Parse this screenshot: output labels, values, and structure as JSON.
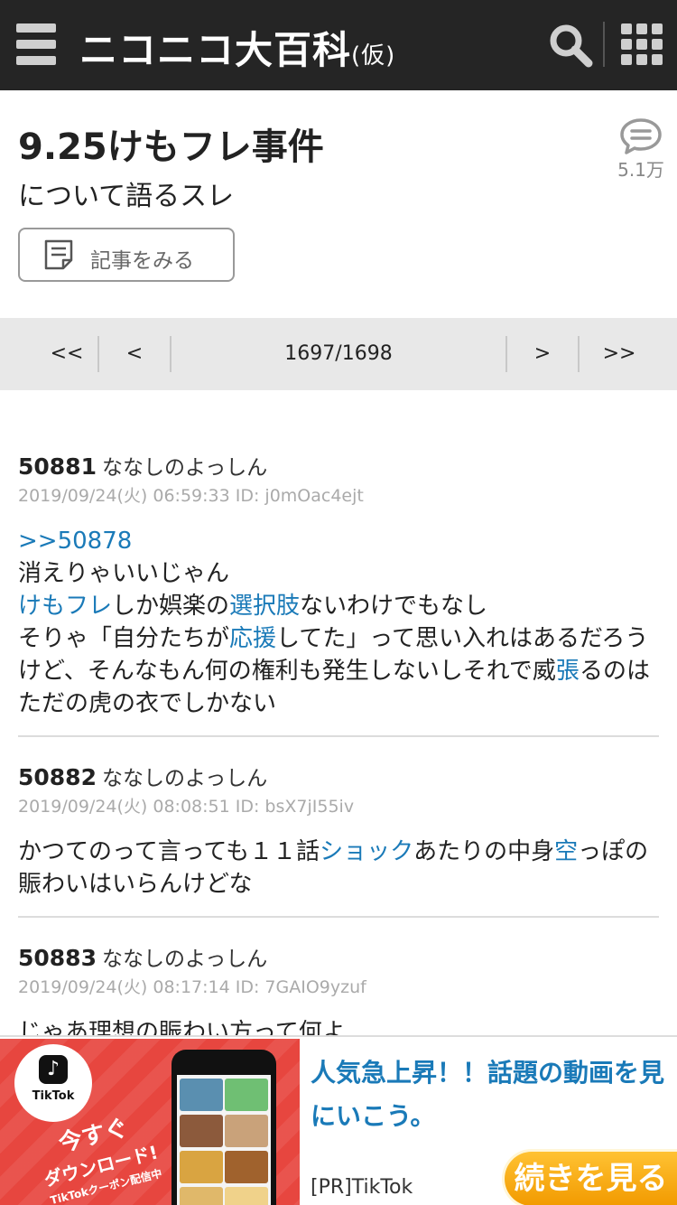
{
  "header": {
    "site_name": "ニコニコ大百科",
    "site_name_suffix": "(仮)",
    "menu_icon": "hamburger-icon",
    "search_icon": "search-icon",
    "apps_icon": "grid-icon",
    "bg_color": "#252525"
  },
  "article": {
    "title": "9.25けもフレ事件",
    "subtitle": "について語るスレ",
    "comment_count": "5.1万",
    "view_article_label": "記事をみる"
  },
  "pager": {
    "first": "<<",
    "prev": "<",
    "position": "1697/1698",
    "next": ">",
    "last": ">>"
  },
  "posts": [
    {
      "number": "50881",
      "name": "ななしのよっしん",
      "meta": "2019/09/24(火) 06:59:33 ID: j0mOac4ejt",
      "reply_link": ">>50878",
      "line1": "消えりゃいいじゃん",
      "link_kemofure": "けもフレ",
      "text_a": "しか娯楽の",
      "link_sentakushi": "選択肢",
      "text_b": "ないわけでもなし",
      "text_c": "そりゃ「自分たちが",
      "link_ouen": "応援",
      "text_d": "してた」って思い入れはあるだろうけど、そんなもん何の権利も発生しないしそれで威",
      "link_haru": "張",
      "text_e": "るのはただの虎の衣でしかない"
    },
    {
      "number": "50882",
      "name": "ななしのよっしん",
      "meta": "2019/09/24(火) 08:08:51 ID: bsX7jI55iv",
      "text_a": "かつてのって言っても１１話",
      "link_shock": "ショック",
      "text_b": "あたりの中身",
      "link_kara": "空",
      "text_c": "っぽの賑わいはいらんけどな"
    },
    {
      "number": "50883",
      "name": "ななしのよっしん",
      "meta": "2019/09/24(火) 08:17:14 ID: 7GAIO9yzuf",
      "text_a": "じゃあ理想の賑わい方って何よ"
    }
  ],
  "ad": {
    "badge_name": "TikTok",
    "promo_line1": "今すぐ",
    "promo_line2": "ダウンロード!",
    "promo_line3": "TikTokクーポン配信中",
    "headline": "人気急上昇！！話題の動画を見にいこう。",
    "source": "[PR]TikTok",
    "cta": "続きを見る",
    "accent_color": "#1a7ab8",
    "cta_color": "#f5a400"
  },
  "colors": {
    "link": "#1a7ab8",
    "meta_text": "#aaaaaa",
    "pager_bg": "#e8e8e8"
  }
}
